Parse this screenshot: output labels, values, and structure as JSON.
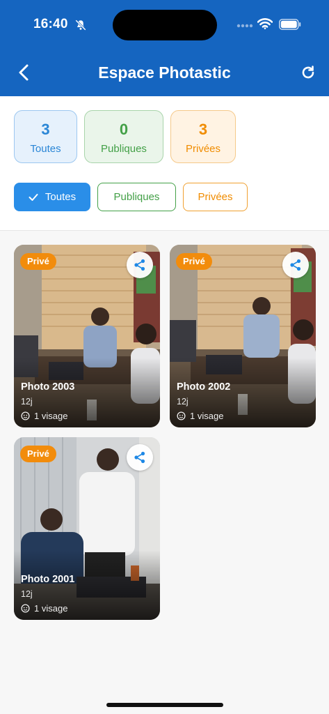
{
  "status_bar": {
    "time": "16:40"
  },
  "header": {
    "title": "Espace Photastic"
  },
  "stats": [
    {
      "count": "3",
      "label": "Toutes"
    },
    {
      "count": "0",
      "label": "Publiques"
    },
    {
      "count": "3",
      "label": "Privées"
    }
  ],
  "filters": {
    "all": "Toutes",
    "public": "Publiques",
    "private": "Privées",
    "selected": "Toutes"
  },
  "photos": [
    {
      "title": "Photo 2003",
      "age": "12j",
      "faces": "1 visage",
      "badge": "Privé"
    },
    {
      "title": "Photo 2002",
      "age": "12j",
      "faces": "1 visage",
      "badge": "Privé"
    },
    {
      "title": "Photo 2001",
      "age": "12j",
      "faces": "1 visage",
      "badge": "Privé"
    }
  ],
  "colors": {
    "header": "#1565c0",
    "accent_blue": "#2a8ee8",
    "public_green": "#43a047",
    "private_orange": "#f08c00"
  },
  "icons": [
    "back-arrow-icon",
    "refresh-icon",
    "check-icon",
    "share-icon",
    "face-icon",
    "bell-off-icon",
    "wifi-icon",
    "battery-icon"
  ]
}
